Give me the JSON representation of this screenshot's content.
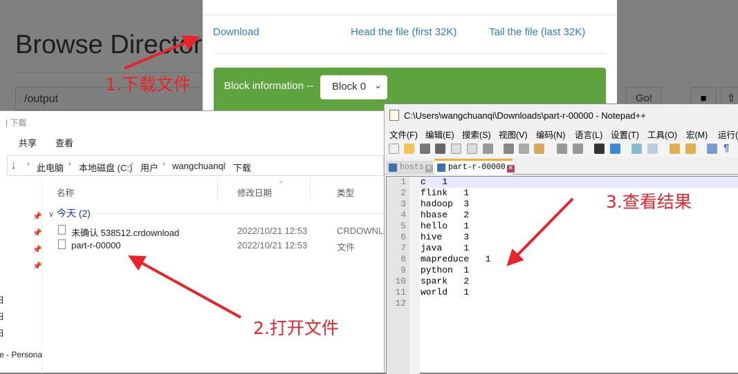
{
  "browser": {
    "page_title": "Browse Director",
    "path_value": "/output",
    "go_label": "Go!",
    "icons": [
      "folder-icon",
      "upload-icon"
    ]
  },
  "modal": {
    "links": [
      "Download",
      "Head the file (first 32K)",
      "Tail the file (last 32K)"
    ],
    "block_label": "Block information --",
    "block_select_value": "Block 0",
    "panel_color": "#5fa33e"
  },
  "explorer": {
    "title": "下载",
    "ribbon": [
      "共享",
      "查看"
    ],
    "breadcrumb": [
      "此电脑",
      "本地磁盘 (C:)",
      "用户",
      "wangchuanqi",
      "下载"
    ],
    "columns": [
      "名称",
      "修改日期",
      "类型"
    ],
    "group": "今天 (2)",
    "files": [
      {
        "name": "未确认 538512.crdownload",
        "date": "2022/10/21 12:53",
        "type": "CRDOWNLO"
      },
      {
        "name": "part-r-00000",
        "date": "2022/10/21 12:53",
        "type": "文件"
      }
    ],
    "nav_partial": [
      "日",
      "日",
      "日",
      "e - Persona"
    ]
  },
  "notepad": {
    "title": "C:\\Users\\wangchuanqi\\Downloads\\part-r-00000 - Notepad++",
    "menu": [
      "文件(F)",
      "编辑(E)",
      "搜索(S)",
      "视图(V)",
      "编码(N)",
      "语言(L)",
      "设置(T)",
      "工具(O)",
      "宏(M)",
      "运行(R)"
    ],
    "tabs": [
      {
        "label": "hosts",
        "active": false
      },
      {
        "label": "part-r-00000",
        "active": true
      }
    ],
    "line_numbers": "1\n2\n3\n4\n5\n6\n7\n8\n9\n10\n11\n12",
    "content": "c\t1\nflink\t1\nhadoop\t3\nhbase\t2\nhello\t1\nhive\t3\njava\t1\nmapreduce\t1\npython\t1\nspark\t2\nworld\t1\n"
  },
  "annotations": {
    "step1": "1.下载文件",
    "step2": "2.打开文件",
    "step3": "3.查看结果",
    "color": "#e8232a"
  }
}
